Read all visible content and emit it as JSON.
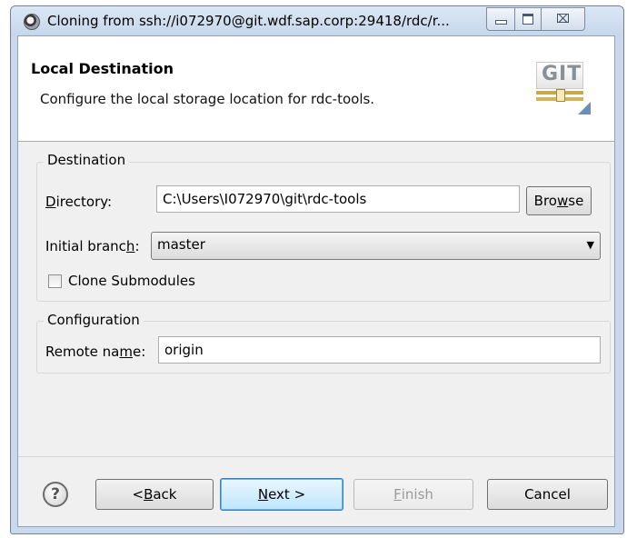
{
  "window": {
    "title": "Cloning from ssh://i072970@git.wdf.sap.corp:29418/rdc/r...",
    "min_icon": "minimize-icon",
    "max_icon": "maximize-icon",
    "close_glyph": "⌧"
  },
  "header": {
    "title": "Local Destination",
    "description": "Configure the local storage location for rdc-tools.",
    "logo_text": "GIT"
  },
  "destination": {
    "legend": "Destination",
    "directory_label": {
      "pre": "",
      "accel": "D",
      "post": "irectory:"
    },
    "directory_value": "C:\\Users\\I072970\\git\\rdc-tools",
    "browse_label": {
      "pre": "Bro",
      "accel": "w",
      "post": "se"
    },
    "branch_label": {
      "pre": "Initial branc",
      "accel": "h",
      "post": ":"
    },
    "branch_value": "master",
    "submodules_label": "Clone Submodules",
    "submodules_checked": false
  },
  "configuration": {
    "legend": "Configuration",
    "remote_label": {
      "pre": "Remote na",
      "accel": "m",
      "post": "e:"
    },
    "remote_value": "origin"
  },
  "footer": {
    "help_glyph": "?",
    "back_label": {
      "pre": "< ",
      "accel": "B",
      "post": "ack"
    },
    "next_label": {
      "pre": "",
      "accel": "N",
      "post": "ext >"
    },
    "finish_label": {
      "pre": "",
      "accel": "F",
      "post": "inish"
    },
    "cancel_label": "Cancel"
  },
  "colors": {
    "titlebar": "#c6d6ea",
    "default_button_border": "#3c7fb1"
  }
}
